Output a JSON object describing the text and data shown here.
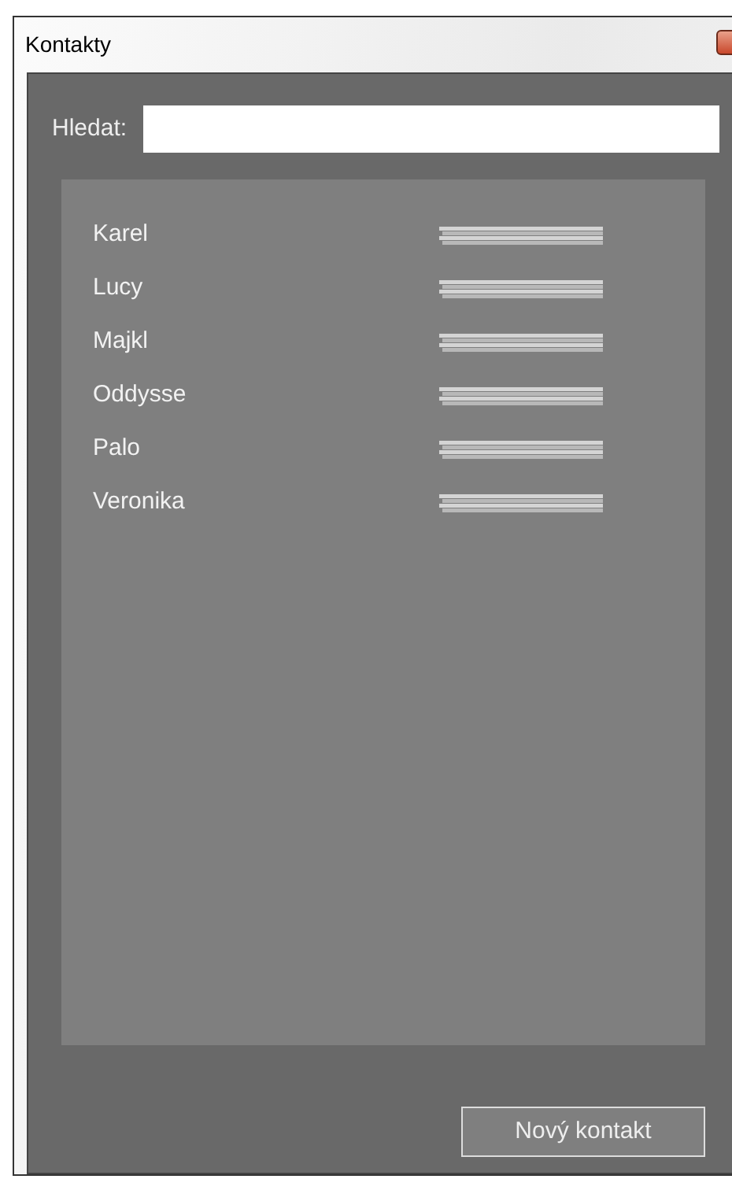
{
  "window": {
    "title": "Kontakty"
  },
  "search": {
    "label": "Hledat:"
  },
  "contacts": [
    {
      "name": "Karel"
    },
    {
      "name": "Lucy"
    },
    {
      "name": "Majkl"
    },
    {
      "name": "Oddysse"
    },
    {
      "name": "Palo"
    },
    {
      "name": "Veronika"
    }
  ],
  "buttons": [
    "Nový kontakt"
  ]
}
